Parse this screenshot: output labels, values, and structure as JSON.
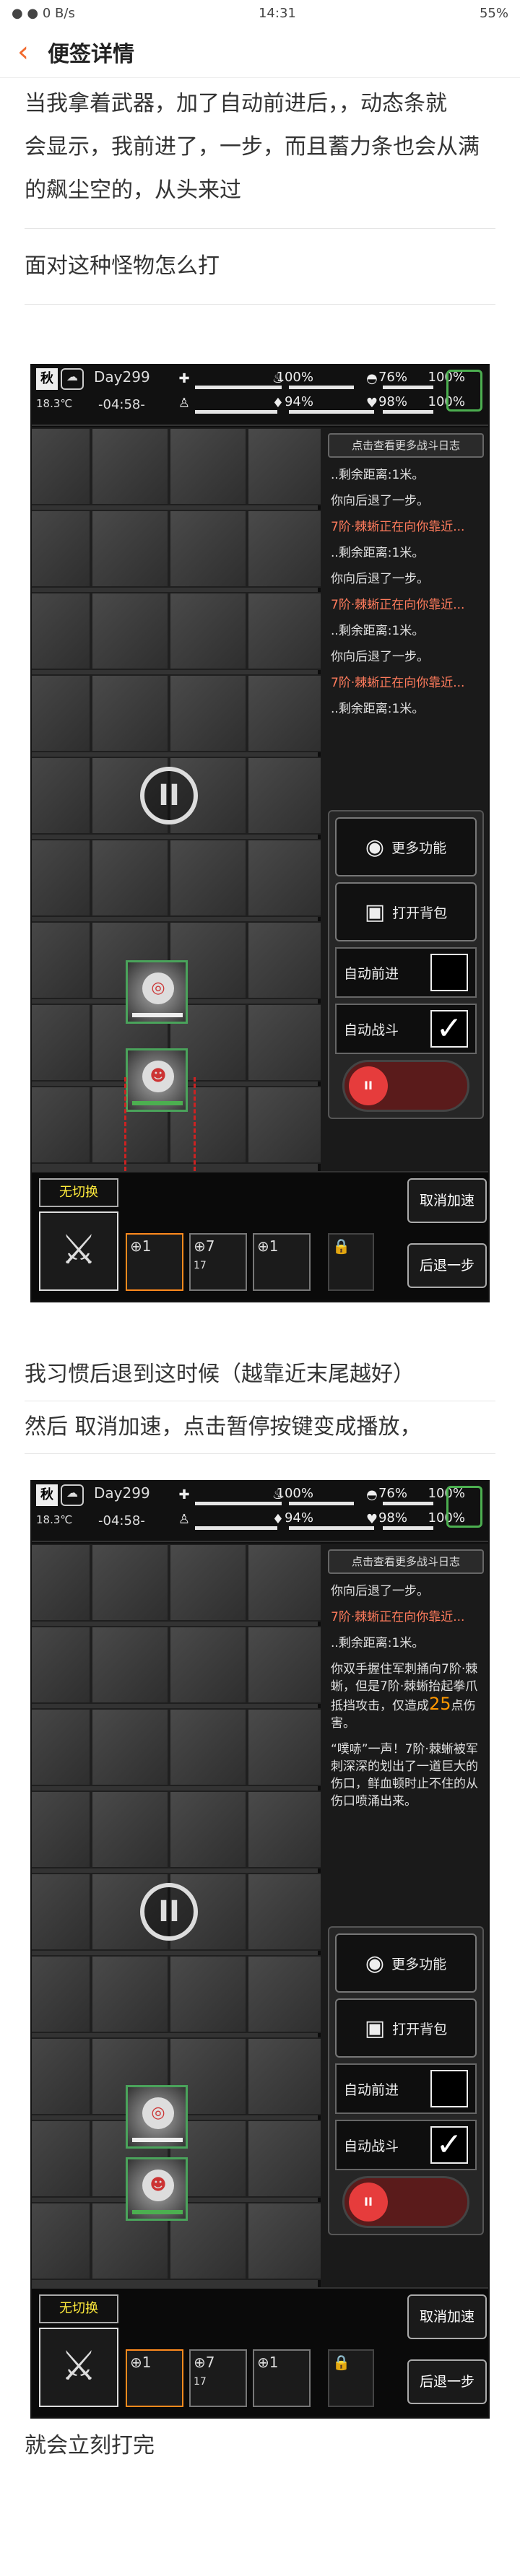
{
  "status_bar": {
    "left": "● ● 0 B/s",
    "time": "14:31",
    "right": "55%"
  },
  "header": {
    "title": "便签详情"
  },
  "paragraphs": {
    "p1": "当我拿着武器，加了自动前进后，，动态条就",
    "p2": "会显示，我前进了，一步，而且蓄力条也会从满",
    "p3": "的飙尘空的，从头来过",
    "p4": "面对这种怪物怎么打",
    "p5": "我习惯后退到这时候（越靠近末尾越好）",
    "p6": "然后 取消加速，点击暂停按键变成播放，",
    "p7": "就会立刻打完"
  },
  "game": {
    "season": "秋",
    "temp": "18.3℃",
    "day": "Day299",
    "clock": "-04:58-",
    "stats": [
      {
        "pct": "100%"
      },
      {
        "pct": "76%"
      },
      {
        "pct": "100%"
      },
      {
        "pct": "94%"
      },
      {
        "pct": "98%"
      },
      {
        "pct": "100%"
      }
    ],
    "log_button": "点击查看更多战斗日志",
    "menu_more": "更多功能",
    "menu_bag": "打开背包",
    "auto_forward": "自动前进",
    "auto_battle": "自动战斗",
    "no_switch": "无切换",
    "cancel_speed": "取消加速",
    "step_back": "后退一步",
    "slots": [
      {
        "num": "1"
      },
      {
        "num": "7"
      },
      {
        "num": "1"
      }
    ],
    "slot_count": "17"
  },
  "shot1": {
    "log": [
      {
        "text": "..剩余距离:1米。"
      },
      {
        "text": "你向后退了一步。"
      },
      {
        "text": "7阶·棘蜥正在向你靠近...",
        "m": true
      },
      {
        "text": "..剩余距离:1米。"
      },
      {
        "text": "你向后退了一步。"
      },
      {
        "text": "7阶·棘蜥正在向你靠近...",
        "m": true
      },
      {
        "text": "..剩余距离:1米。"
      },
      {
        "text": "你向后退了一步。"
      },
      {
        "text": "7阶·棘蜥正在向你靠近...",
        "m": true
      },
      {
        "text": "..剩余距离:1米。"
      }
    ]
  },
  "shot2": {
    "log": [
      {
        "text": "你向后退了一步。"
      },
      {
        "text": "7阶·棘蜥正在向你靠近...",
        "m": true
      },
      {
        "text": "..剩余距离:1米。"
      },
      {
        "text": "你双手握住军刺捅向7阶·棘蜥，但是7阶·棘蜥抬起拳爪抵挡攻击，仅造成"
      },
      {
        "text": "点伤害。"
      },
      {
        "text": "“噗哧”一声！7阶·棘蜥被军刺深深的划出了一道巨大的伤口，鲜血顿时止不住的从伤口喷涌出来。"
      }
    ],
    "damage": "25"
  }
}
